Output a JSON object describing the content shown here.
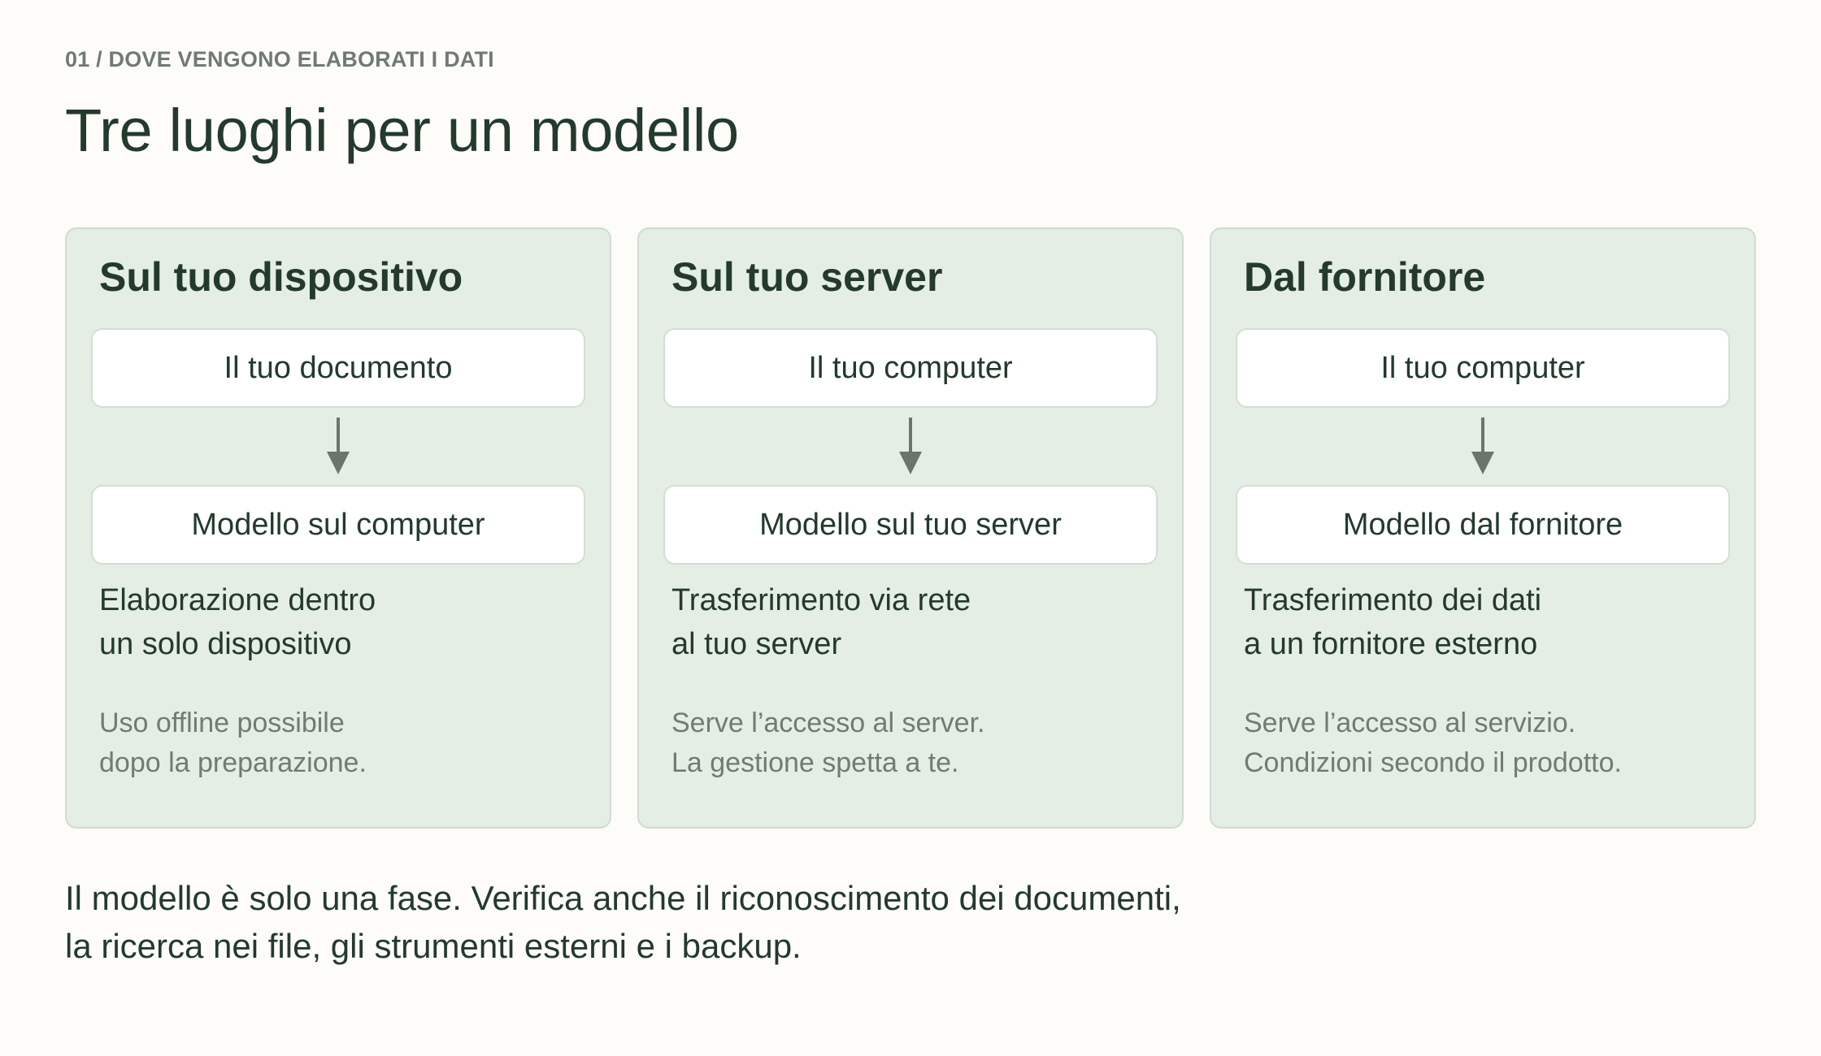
{
  "header": {
    "eyebrow": "01 / DOVE VENGONO ELABORATI I DATI",
    "title": "Tre luoghi per un modello"
  },
  "cards": [
    {
      "title": "Sul tuo dispositivo",
      "top_box": "Il tuo documento",
      "bottom_box": "Modello sul computer",
      "description": [
        "Elaborazione dentro",
        "un solo dispositivo"
      ],
      "note": [
        "Uso offline possibile",
        "dopo la preparazione."
      ]
    },
    {
      "title": "Sul tuo server",
      "top_box": "Il tuo computer",
      "bottom_box": "Modello sul tuo server",
      "description": [
        "Trasferimento via rete",
        "al tuo server"
      ],
      "note": [
        "Serve l’accesso al server.",
        "La gestione spetta a te."
      ]
    },
    {
      "title": "Dal fornitore",
      "top_box": "Il tuo computer",
      "bottom_box": "Modello dal fornitore",
      "description": [
        "Trasferimento dei dati",
        "a un fornitore esterno"
      ],
      "note": [
        "Serve l’accesso al servizio.",
        "Condizioni secondo il prodotto."
      ]
    }
  ],
  "footer": {
    "lines": [
      "Il modello è solo una fase. Verifica anche il riconoscimento dei documenti,",
      "la ricerca nei file, gli strumenti esterni e i backup."
    ]
  },
  "colors": {
    "background": "#fdfcf9",
    "card_fill": "#e4eee5",
    "card_border": "#cfdccf",
    "node_fill": "#ffffff",
    "text_primary": "#233a2d",
    "text_muted": "#717b74",
    "arrow": "#6a756e"
  },
  "icons": {
    "flow_arrow": "arrow-down-icon"
  }
}
